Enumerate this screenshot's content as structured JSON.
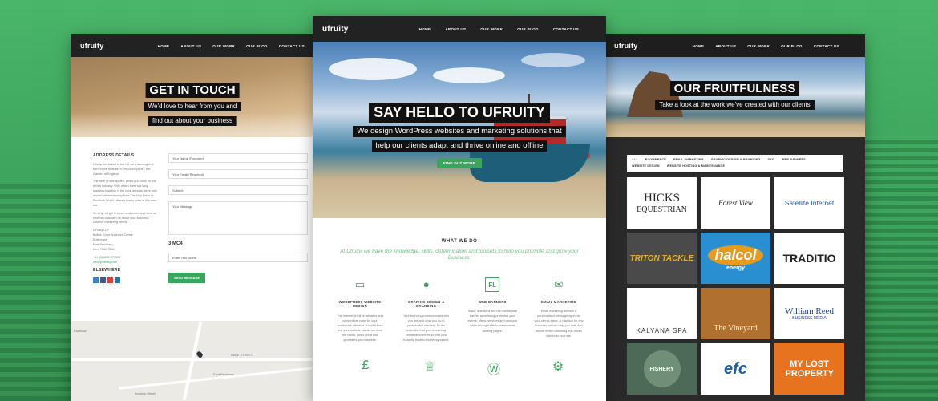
{
  "colors": {
    "accent": "#3aa55c",
    "background": "#3a9e5c",
    "nav": "#222222"
  },
  "left": {
    "logo": "ufruity",
    "menu": [
      "HOME",
      "ABOUT US",
      "OUR WORK",
      "OUR BLOG",
      "CONTACT US"
    ],
    "hero_title": "GET IN TOUCH",
    "hero_sub_line1": "We'd love to hear from you and",
    "hero_sub_line2": "find out about your business",
    "address_heading": "ADDRESS DETAILS",
    "address_p1": "Ufruity are based in the UK on a working fruit farm in the beautiful Kent countryside - the Garden of England.",
    "address_p2": "The farm grows apples, pears and hops for the drinks industry. With which there's a long standing tradition in the local area as we're only a short distance away from The Hop Farm at Paddock Wood - there's lovely pubs in the area too.",
    "address_p3": "So why not get in touch and come and have an informal chat with us about your business creative marketing needs.",
    "address_company": "UFruity LLP",
    "address_line1": "Boltek Court Business Centre",
    "address_line2": "Boltercane",
    "address_line3": "East Peckham",
    "address_line4": "Kent TN12 5LW",
    "phone": "+44 (0)1622 873027",
    "email": "hello@ufruity.com",
    "elsewhere": "ELSEWHERE",
    "form_name": "Your Name (Required)",
    "form_email": "Your Email (Required)",
    "form_subject": "Subject",
    "form_message": "Your Message",
    "captcha": "3 MC4",
    "form_captcha": "Enter Text Above",
    "send_label": "SEND MESSAGE",
    "map_label1": "HALE STREET",
    "map_label2": "East Peckham",
    "map_label3": "Borders Street",
    "map_label4": "Paddock"
  },
  "center": {
    "logo": "ufruity",
    "menu": [
      "HOME",
      "ABOUT US",
      "OUR WORK",
      "OUR BLOG",
      "CONTACT US"
    ],
    "hero_title": "SAY HELLO TO UFRUITY",
    "hero_sub_line1": "We design WordPress websites and marketing solutions that",
    "hero_sub_line2": "help our clients adapt and thrive online and offline",
    "cta": "FIND OUT MORE",
    "what_title": "WHAT WE DO",
    "what_lead": "At Ufruity, we have the knowledge, skills, determination and toolsets to help you promote and grow your Business.",
    "services": [
      {
        "icon": "monitor-icon",
        "title": "WORDPRESS WEBSITE DESIGN",
        "text": "The internet is full of websites and competitors vying for your audience's attention. It's vital then that your website stands out from the crowd, looks great and generates you business."
      },
      {
        "icon": "leaf-icon",
        "title": "GRAPHIC DESIGN & BRANDING",
        "text": "Your branding communicates who you are and what you do to prospective clientele. So it's essential that your marketing collateral matches so that your instantly trusted and recognisable."
      },
      {
        "icon": "flash-icon",
        "title": "WEB BANNERS",
        "text": "Static, animated and rich media web banner advertising promotes your events, offers, services and products while driving traffic to measurable landing pages."
      },
      {
        "icon": "mailbox-icon",
        "title": "EMAIL MARKETING",
        "text": "Email marketing delivers a personalised message right into your clients inbox. A vital tool for any business we can help you craft and deliver email marketing that drives visitors to your site."
      }
    ]
  },
  "right": {
    "logo": "ufruity",
    "menu": [
      "HOME",
      "ABOUT US",
      "OUR WORK",
      "OUR BLOG",
      "CONTACT US"
    ],
    "hero_title": "OUR FRUITFULNESS",
    "hero_sub": "Take a look at the work we've created with our clients",
    "filters": [
      "ALL",
      "ECOMMERCE",
      "EMAIL MARKETING",
      "GRAPHIC DESIGN & BRANDING",
      "SEO",
      "WEB BANNERS",
      "WEBSITE DESIGN",
      "WEBSITE HOSTING & MAINTENANCE"
    ],
    "tiles": [
      {
        "name": "HICKS",
        "sub": "EQUESTRIAN"
      },
      {
        "name": "Forest View",
        "sub": ""
      },
      {
        "name": "Satellite Internet",
        "sub": ""
      },
      {
        "name": "TRITON TACKLE",
        "sub": ""
      },
      {
        "name": "halcol",
        "sub": "energy"
      },
      {
        "name": "TRADITIO",
        "sub": ""
      },
      {
        "name": "KALYANA SPA",
        "sub": ""
      },
      {
        "name": "The Vineyard",
        "sub": ""
      },
      {
        "name": "William Reed",
        "sub": "BUSINESS MEDIA"
      },
      {
        "name": "FISHERY",
        "sub": ""
      },
      {
        "name": "efc",
        "sub": ""
      },
      {
        "name": "MY LOST PROPERTY",
        "sub": ""
      }
    ]
  }
}
